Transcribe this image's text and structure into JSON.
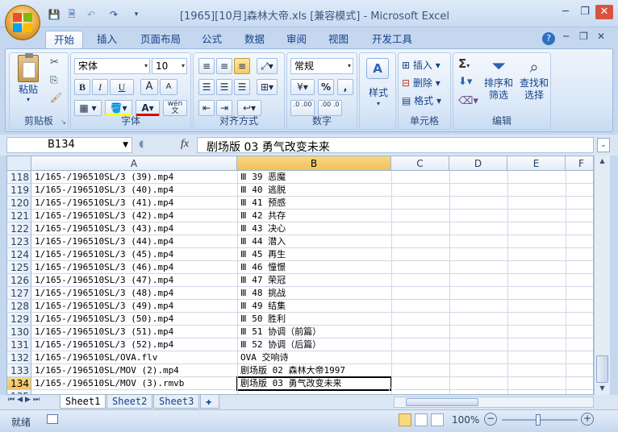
{
  "window": {
    "title": "[1965][10月]森林大帝.xls  [兼容模式] - Microsoft Excel",
    "minimize": "─",
    "restore": "❐",
    "close": "✕"
  },
  "quick_access": {
    "save": "💾",
    "undo": "↶",
    "redo": "↷",
    "customize": "▾"
  },
  "tabs": [
    "开始",
    "插入",
    "页面布局",
    "公式",
    "数据",
    "审阅",
    "视图",
    "开发工具"
  ],
  "ribbon": {
    "clipboard": {
      "label": "剪贴板",
      "paste": "粘贴"
    },
    "font": {
      "label": "字体",
      "name": "宋体",
      "size": "10",
      "bold": "B",
      "italic": "I",
      "underline": "U",
      "grow": "A",
      "shrink": "A",
      "fill_color": "A",
      "font_color": "A",
      "wen": "wén 文"
    },
    "alignment": {
      "label": "对齐方式"
    },
    "number": {
      "label": "数字",
      "format": "常规",
      "percent": "%",
      "comma": ",",
      "inc": ".0 .00",
      "dec": ".00 .0"
    },
    "styles": {
      "label": "样式"
    },
    "cells": {
      "label": "单元格",
      "insert": "插入",
      "delete": "删除",
      "format": "格式"
    },
    "editing": {
      "label": "编辑",
      "sum": "Σ",
      "sort": "排序和\n筛选",
      "find": "查找和\n选择"
    }
  },
  "formula_bar": {
    "name_box": "B134",
    "fx": "fx",
    "content": "剧场版 03 勇气改变未来"
  },
  "columns": [
    "A",
    "B",
    "C",
    "D",
    "E",
    "F"
  ],
  "rows": [
    {
      "num": "118",
      "a": "1/165-/196510SL/3 (39).mp4",
      "b": "Ⅲ 39 恶魔"
    },
    {
      "num": "119",
      "a": "1/165-/196510SL/3 (40).mp4",
      "b": "Ⅲ 40 逃脱"
    },
    {
      "num": "120",
      "a": "1/165-/196510SL/3 (41).mp4",
      "b": "Ⅲ 41 预感"
    },
    {
      "num": "121",
      "a": "1/165-/196510SL/3 (42).mp4",
      "b": "Ⅲ 42 共存"
    },
    {
      "num": "122",
      "a": "1/165-/196510SL/3 (43).mp4",
      "b": "Ⅲ 43 决心"
    },
    {
      "num": "123",
      "a": "1/165-/196510SL/3 (44).mp4",
      "b": "Ⅲ 44 潜入"
    },
    {
      "num": "124",
      "a": "1/165-/196510SL/3 (45).mp4",
      "b": "Ⅲ 45 再生"
    },
    {
      "num": "125",
      "a": "1/165-/196510SL/3 (46).mp4",
      "b": "Ⅲ 46 憧憬"
    },
    {
      "num": "126",
      "a": "1/165-/196510SL/3 (47).mp4",
      "b": "Ⅲ 47 荣冠"
    },
    {
      "num": "127",
      "a": "1/165-/196510SL/3 (48).mp4",
      "b": "Ⅲ 48 挑战"
    },
    {
      "num": "128",
      "a": "1/165-/196510SL/3 (49).mp4",
      "b": "Ⅲ 49 结集"
    },
    {
      "num": "129",
      "a": "1/165-/196510SL/3 (50).mp4",
      "b": "Ⅲ 50 胜利"
    },
    {
      "num": "130",
      "a": "1/165-/196510SL/3 (51).mp4",
      "b": "Ⅲ 51 协调（前篇）"
    },
    {
      "num": "131",
      "a": "1/165-/196510SL/3 (52).mp4",
      "b": "Ⅲ 52 协调（后篇）"
    },
    {
      "num": "132",
      "a": "1/165-/196510SL/OVA.flv",
      "b": "OVA 交响诗"
    },
    {
      "num": "133",
      "a": "1/165-/196510SL/MOV (2).mp4",
      "b": "剧场版 02 森林大帝1997"
    },
    {
      "num": "134",
      "a": "1/165-/196510SL/MOV (3).rmvb",
      "b": "剧场版 03 勇气改变未来"
    },
    {
      "num": "135",
      "a": "",
      "b": ""
    }
  ],
  "sheets": [
    "Sheet1",
    "Sheet2",
    "Sheet3"
  ],
  "status": {
    "ready": "就绪",
    "zoom": "100%"
  },
  "colors": {
    "accent": "#15428b",
    "selection": "#f1c15f"
  }
}
